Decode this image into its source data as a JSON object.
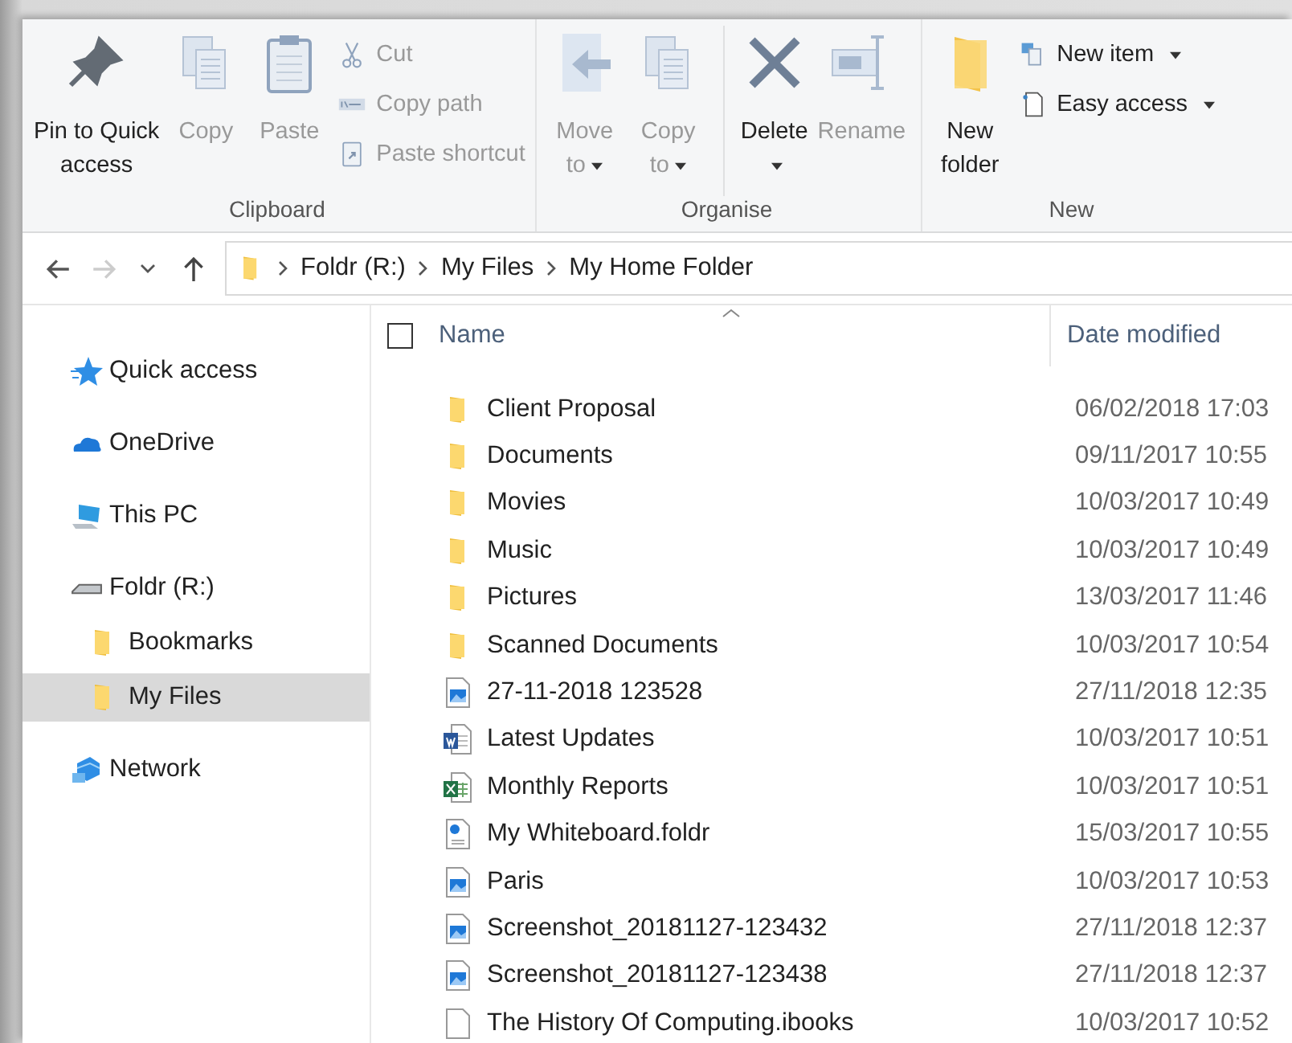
{
  "ribbon": {
    "groups": [
      {
        "label": "Clipboard",
        "items": [
          {
            "kind": "large",
            "lines": [
              "Pin to Quick",
              "access"
            ],
            "disabled": false,
            "dropdown": false,
            "separated": false
          },
          {
            "kind": "large",
            "lines": [
              "Copy"
            ],
            "disabled": true,
            "dropdown": false,
            "separated": false
          },
          {
            "kind": "large",
            "lines": [
              "Paste"
            ],
            "disabled": true,
            "dropdown": false,
            "separated": false
          },
          {
            "kind": "small",
            "lines": [
              "Cut"
            ],
            "disabled": true,
            "dropdown": false,
            "separated": false
          },
          {
            "kind": "small",
            "lines": [
              "Copy path"
            ],
            "disabled": true,
            "dropdown": false,
            "separated": false
          },
          {
            "kind": "small",
            "lines": [
              "Paste shortcut"
            ],
            "disabled": true,
            "dropdown": false,
            "separated": false
          }
        ]
      },
      {
        "label": "Organise",
        "items": [
          {
            "kind": "large",
            "lines": [
              "Move",
              "to"
            ],
            "disabled": true,
            "dropdown": true,
            "separated": false
          },
          {
            "kind": "large",
            "lines": [
              "Copy",
              "to"
            ],
            "disabled": true,
            "dropdown": true,
            "separated": false
          },
          {
            "kind": "large",
            "lines": [
              "Delete"
            ],
            "disabled": false,
            "dropdown": true,
            "separated": true
          },
          {
            "kind": "large",
            "lines": [
              "Rename"
            ],
            "disabled": true,
            "dropdown": false,
            "separated": false
          }
        ]
      },
      {
        "label": "New",
        "items": [
          {
            "kind": "large",
            "lines": [
              "New",
              "folder"
            ],
            "disabled": false,
            "dropdown": false,
            "separated": false
          },
          {
            "kind": "small",
            "lines": [
              "New item"
            ],
            "disabled": false,
            "dropdown": true,
            "separated": false
          },
          {
            "kind": "small",
            "lines": [
              "Easy access"
            ],
            "disabled": false,
            "dropdown": true,
            "separated": false
          }
        ]
      }
    ]
  },
  "navigation": {
    "back_disabled": false,
    "forward_disabled": true
  },
  "address": {
    "crumbs": [
      "Foldr (R:)",
      "My Files",
      "My Home Folder"
    ]
  },
  "sidebar": {
    "items": [
      {
        "label": "Quick access",
        "selected": false
      },
      {
        "label": "OneDrive",
        "selected": false
      },
      {
        "label": "This PC",
        "selected": false
      },
      {
        "label": "Foldr (R:)",
        "selected": false,
        "children": [
          {
            "label": "Bookmarks",
            "selected": false
          },
          {
            "label": "My Files",
            "selected": true
          }
        ]
      },
      {
        "label": "Network",
        "selected": false
      }
    ]
  },
  "table": {
    "select_all": false,
    "columns": [
      "Name",
      "Date modified"
    ],
    "rows": [
      {
        "name": "Client Proposal",
        "date": "06/02/2018 17:03",
        "kind": "folder"
      },
      {
        "name": "Documents",
        "date": "09/11/2017 10:55",
        "kind": "folder"
      },
      {
        "name": "Movies",
        "date": "10/03/2017 10:49",
        "kind": "folder"
      },
      {
        "name": "Music",
        "date": "10/03/2017 10:49",
        "kind": "folder"
      },
      {
        "name": "Pictures",
        "date": "13/03/2017 11:46",
        "kind": "folder"
      },
      {
        "name": "Scanned Documents",
        "date": "10/03/2017 10:54",
        "kind": "folder"
      },
      {
        "name": "27-11-2018 123528",
        "date": "27/11/2018 12:35",
        "kind": "image"
      },
      {
        "name": "Latest Updates",
        "date": "10/03/2017 10:51",
        "kind": "word"
      },
      {
        "name": "Monthly Reports",
        "date": "10/03/2017 10:51",
        "kind": "excel"
      },
      {
        "name": "My Whiteboard.foldr",
        "date": "15/03/2017 10:55",
        "kind": "whiteboard"
      },
      {
        "name": "Paris",
        "date": "10/03/2017 10:53",
        "kind": "image"
      },
      {
        "name": "Screenshot_20181127-123432",
        "date": "27/11/2018 12:37",
        "kind": "image"
      },
      {
        "name": "Screenshot_20181127-123438",
        "date": "27/11/2018 12:37",
        "kind": "image"
      },
      {
        "name": "The History Of Computing.ibooks",
        "date": "10/03/2017 10:52",
        "kind": "blank"
      }
    ]
  }
}
